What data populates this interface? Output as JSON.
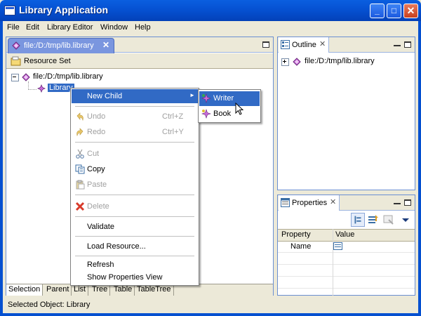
{
  "window": {
    "title": "Library Application",
    "minimize_glyph": "_",
    "restore_glyph": "□",
    "close_glyph": "✕"
  },
  "menubar": [
    "File",
    "Edit",
    "Library Editor",
    "Window",
    "Help"
  ],
  "editor": {
    "tab_label": "file:/D:/tmp/lib.library",
    "tab_close_glyph": "✕",
    "resource_set_label": "Resource Set",
    "tree": {
      "root": "file:/D:/tmp/lib.library",
      "child": "Library"
    },
    "bottom_tabs": [
      "Selection",
      "Parent",
      "List",
      "Tree",
      "Table",
      "TableTree"
    ]
  },
  "context_menu": {
    "items": [
      {
        "label": "New Child",
        "shortcut": "",
        "arrow": "►",
        "state": "highlighted"
      },
      {
        "label": "Undo",
        "shortcut": "Ctrl+Z",
        "state": "disabled"
      },
      {
        "label": "Redo",
        "shortcut": "Ctrl+Y",
        "state": "disabled"
      },
      {
        "label": "Cut",
        "shortcut": "",
        "state": "disabled"
      },
      {
        "label": "Copy",
        "shortcut": "",
        "state": "enabled"
      },
      {
        "label": "Paste",
        "shortcut": "",
        "state": "disabled"
      },
      {
        "label": "Delete",
        "shortcut": "",
        "state": "disabled"
      },
      {
        "label": "Validate",
        "shortcut": "",
        "state": "enabled"
      },
      {
        "label": "Load Resource...",
        "shortcut": "",
        "state": "enabled"
      },
      {
        "label": "Refresh",
        "shortcut": "",
        "state": "enabled"
      },
      {
        "label": "Show Properties View",
        "shortcut": "",
        "state": "enabled"
      }
    ],
    "submenu": [
      {
        "label": "Writer",
        "state": "highlighted"
      },
      {
        "label": "Book",
        "state": "enabled"
      }
    ]
  },
  "outline": {
    "tab_label": "Outline",
    "tree_root": "file:/D:/tmp/lib.library"
  },
  "properties": {
    "tab_label": "Properties",
    "columns": [
      "Property",
      "Value"
    ],
    "rows": [
      {
        "property": "Name",
        "value": ""
      }
    ]
  },
  "status_bar": {
    "text": "Selected Object: Library"
  },
  "colors": {
    "title_bar": "#0550d0",
    "selection": "#316ac5",
    "panel_border": "#6a8fd2",
    "chrome": "#ece9d8"
  }
}
